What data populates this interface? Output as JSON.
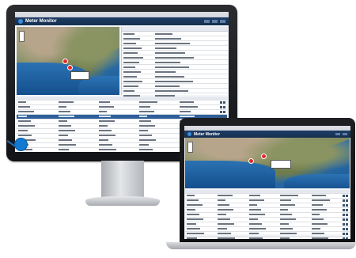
{
  "app": {
    "title": "Meter Monitor"
  },
  "monitor_screen": {
    "details_panel_rows": 14,
    "grid_rows": 12
  },
  "laptop_screen": {
    "grid_rows": 10
  },
  "colors": {
    "header": "#1f3d66",
    "selected_row": "#2f5f9a",
    "accent_dot": "#1279d0",
    "map_pin": "#e02a2a"
  }
}
